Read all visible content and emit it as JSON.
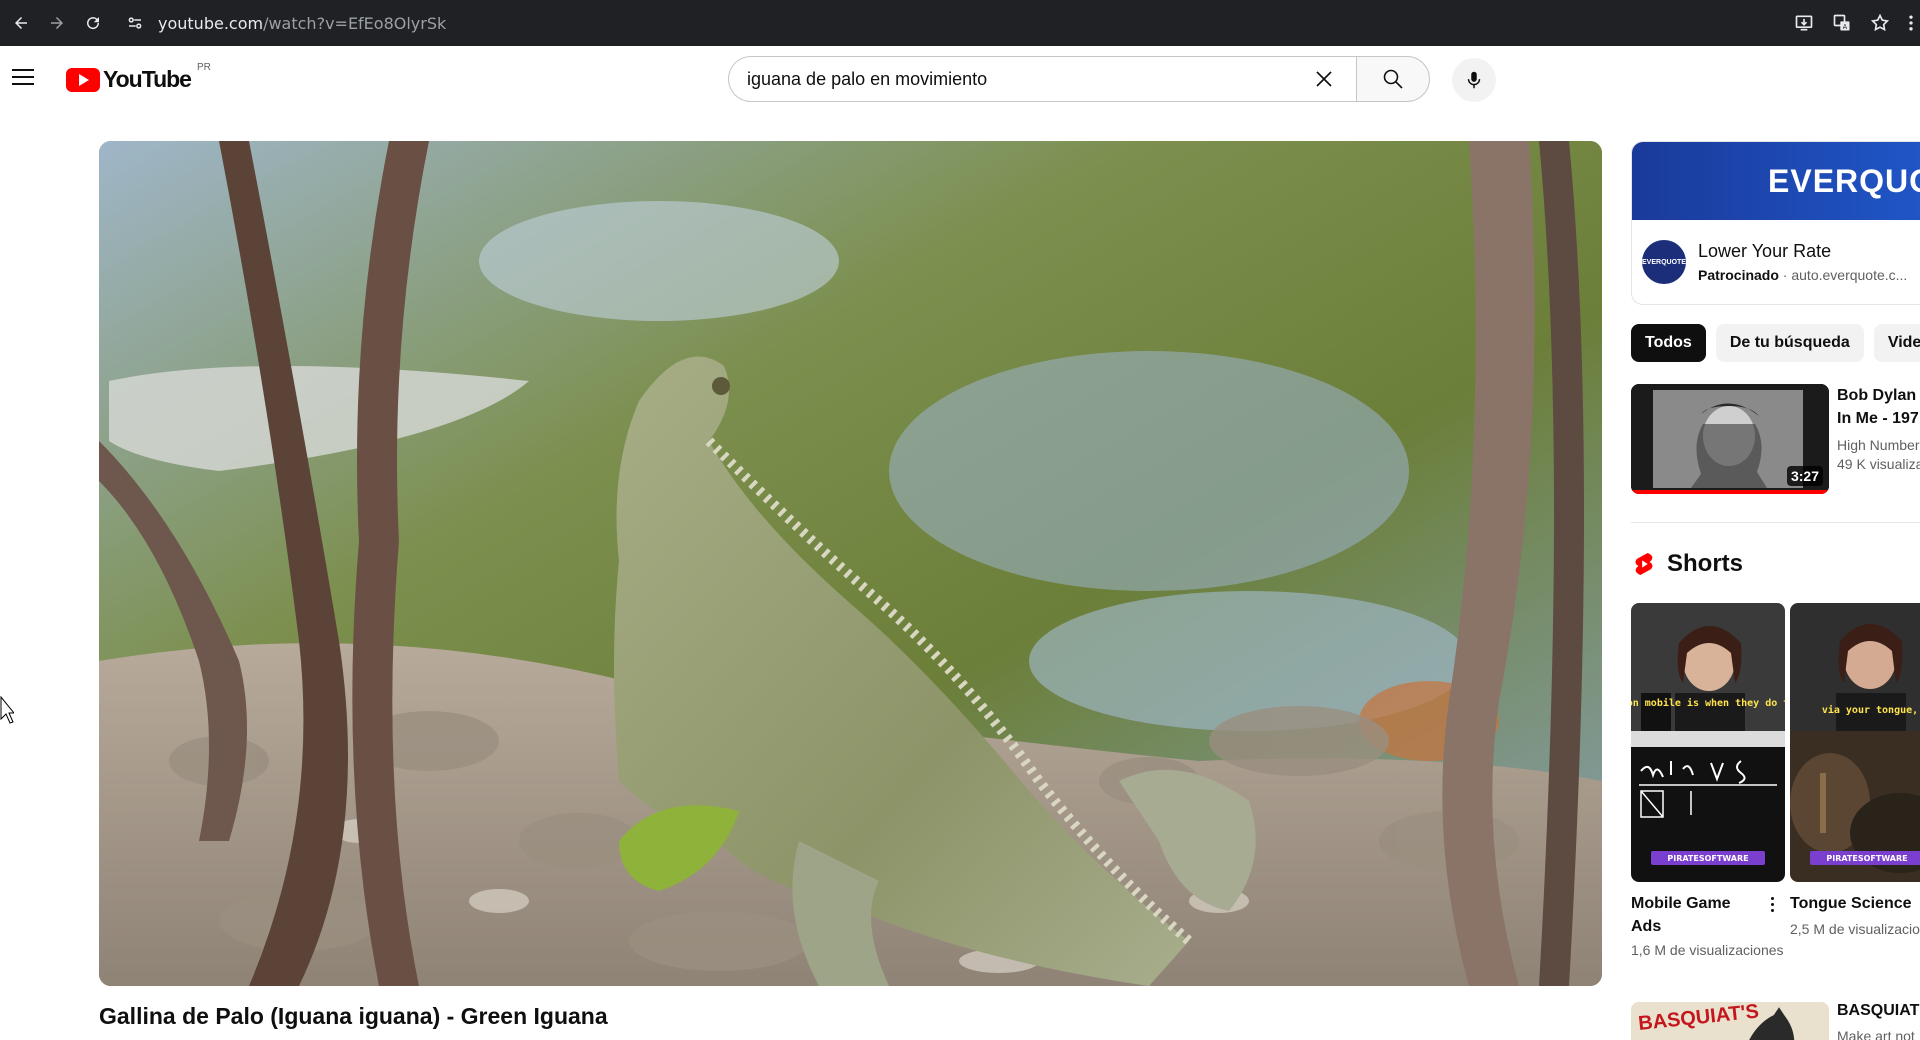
{
  "browser": {
    "url_host": "youtube.com",
    "url_path": "/watch?v=EfEo8OlyrSk"
  },
  "header": {
    "logo_text": "YouTube",
    "region": "PR",
    "search_value": "iguana de palo en movimiento"
  },
  "video": {
    "title": "Gallina de Palo (Iguana iguana) - Green Iguana"
  },
  "sidebar": {
    "ad": {
      "banner_text": "EVERQUO",
      "avatar_text": "EVERQUOTE",
      "title": "Lower Your Rate",
      "sponsored_label": "Patrocinado",
      "domain": "auto.everquote.c..."
    },
    "chips": [
      {
        "label": "Todos",
        "active": true
      },
      {
        "label": "De tu búsqueda",
        "active": false
      },
      {
        "label": "Video",
        "active": false
      }
    ],
    "recommendation": {
      "title_line1": "Bob Dylan F",
      "title_line2": "In Me - 197",
      "channel": "High Number",
      "views": "49 K visualiza",
      "duration": "3:27"
    },
    "shorts": {
      "heading": "Shorts",
      "items": [
        {
          "title_line1": "Mobile Game",
          "title_line2": "Ads",
          "views": "1,6 M de visualizaciones",
          "overlay_top": "ads on mobile is when they do this.",
          "overlay_bottom": "mobile ADs",
          "tag": "PIRATESOFTWARE"
        },
        {
          "title_line1": "Tongue Science",
          "title_line2": "",
          "views": "2,5 M de visualizacio",
          "overlay_top": "via your tongue,",
          "tag": "PIRATESOFTWARE"
        }
      ]
    },
    "next_video": {
      "title": "BASQUIAT'S",
      "subtitle": "Make art not",
      "thumb_text": "BASQUIAT'S"
    }
  }
}
